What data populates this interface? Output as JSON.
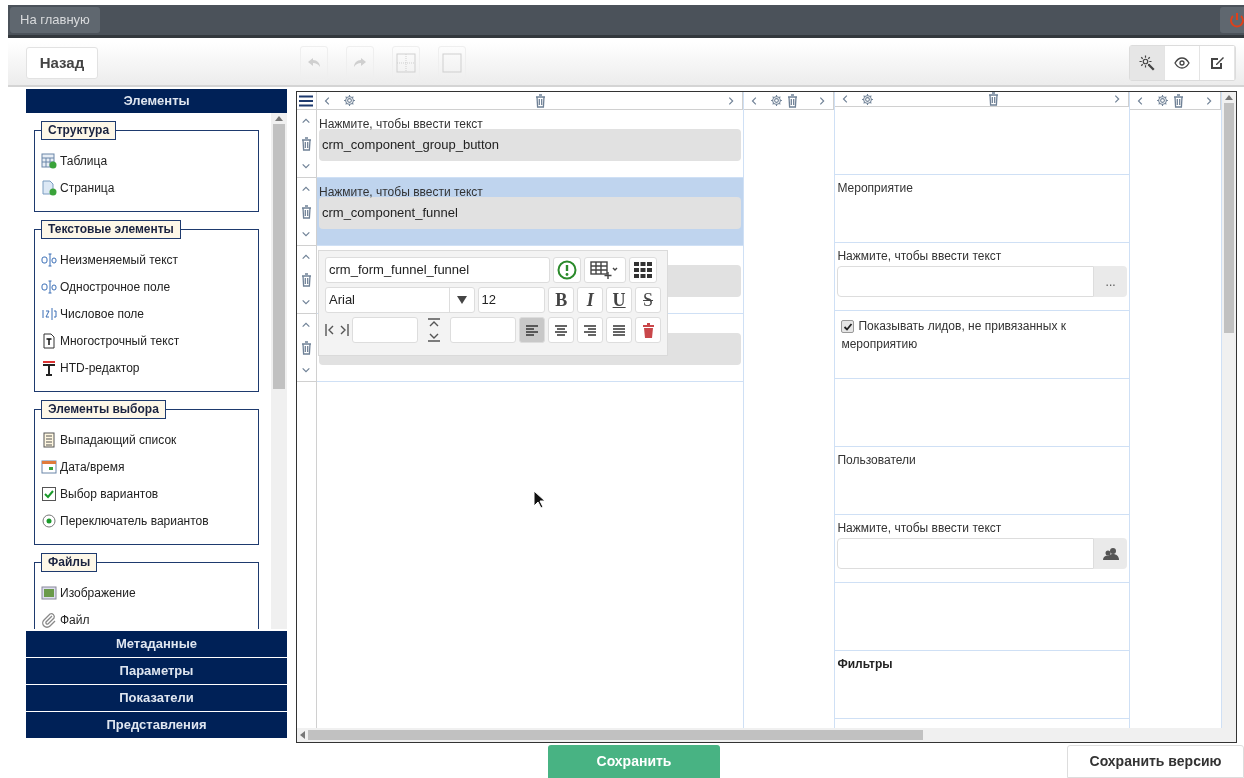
{
  "top_bar": {
    "home_button": "На главную"
  },
  "toolbar": {
    "back_button": "Назад",
    "tools": [
      {
        "kind": "undo",
        "disabled": true
      },
      {
        "kind": "redo",
        "disabled": true
      },
      {
        "kind": "grid",
        "disabled": true
      },
      {
        "kind": "frame",
        "disabled": true
      }
    ],
    "modes": [
      {
        "kind": "design",
        "selected": true
      },
      {
        "kind": "preview",
        "selected": false
      },
      {
        "kind": "edit",
        "selected": false
      }
    ]
  },
  "sidebar": {
    "title": "Элементы",
    "groups": [
      {
        "title": "Структура",
        "items": [
          {
            "kind": "table",
            "label": "Таблица"
          },
          {
            "kind": "page",
            "label": "Страница"
          }
        ]
      },
      {
        "title": "Текстовые элементы",
        "items": [
          {
            "kind": "static",
            "label": "Неизменяемый текст"
          },
          {
            "kind": "line",
            "label": "Однострочное поле"
          },
          {
            "kind": "number",
            "label": "Числовое поле"
          },
          {
            "kind": "multiline",
            "label": "Многострочный текст"
          },
          {
            "kind": "htd",
            "label": "HTD-редактор"
          }
        ]
      },
      {
        "title": "Элементы выбора",
        "items": [
          {
            "kind": "dropdown",
            "label": "Выпадающий список"
          },
          {
            "kind": "date",
            "label": "Дата/время"
          },
          {
            "kind": "checkbox",
            "label": "Выбор вариантов"
          },
          {
            "kind": "radio",
            "label": "Переключатель вариантов"
          }
        ]
      },
      {
        "title": "Файлы",
        "items": [
          {
            "kind": "image",
            "label": "Изображение"
          },
          {
            "kind": "file",
            "label": "Файл"
          }
        ]
      }
    ],
    "sections": [
      "Метаданные",
      "Параметры",
      "Показатели",
      "Представления"
    ]
  },
  "canvas": {
    "left_rows": [
      {
        "label": "Нажмите, чтобы ввести текст",
        "value": "crm_component_group_button",
        "selected": false
      },
      {
        "label": "Нажмите, чтобы ввести текст",
        "value": "crm_component_funnel",
        "selected": true
      },
      {
        "selected": false
      },
      {
        "selected": false
      }
    ],
    "format_popup": {
      "name": "crm_form_funnel_funnel",
      "font": "Arial",
      "size": "12",
      "styles": [
        {
          "kind": "bold",
          "label": "B"
        },
        {
          "kind": "italic",
          "label": "I"
        },
        {
          "kind": "underline",
          "label": "U"
        },
        {
          "kind": "strike",
          "label": "S"
        }
      ],
      "alignments": [
        {
          "kind": "left",
          "selected": true
        },
        {
          "kind": "center",
          "selected": false
        },
        {
          "kind": "right",
          "selected": false
        },
        {
          "kind": "justify",
          "selected": false
        }
      ]
    },
    "right_rows": [
      {
        "kind": "empty"
      },
      {
        "kind": "text",
        "text": "Мероприятие"
      },
      {
        "kind": "lookup",
        "label": "Нажмите, чтобы ввести текст",
        "button": "..."
      },
      {
        "kind": "checkbox",
        "label": "Показывать лидов, не привязанных к мероприятию",
        "checked": true
      },
      {
        "kind": "empty"
      },
      {
        "kind": "text",
        "text": "Пользователи"
      },
      {
        "kind": "users",
        "label": "Нажмите, чтобы ввести текст"
      },
      {
        "kind": "empty"
      },
      {
        "kind": "heading",
        "text": "Фильтры"
      },
      {
        "kind": "empty"
      }
    ]
  },
  "footer": {
    "save_button": "Сохранить",
    "save_version_button": "Сохранить версию"
  }
}
